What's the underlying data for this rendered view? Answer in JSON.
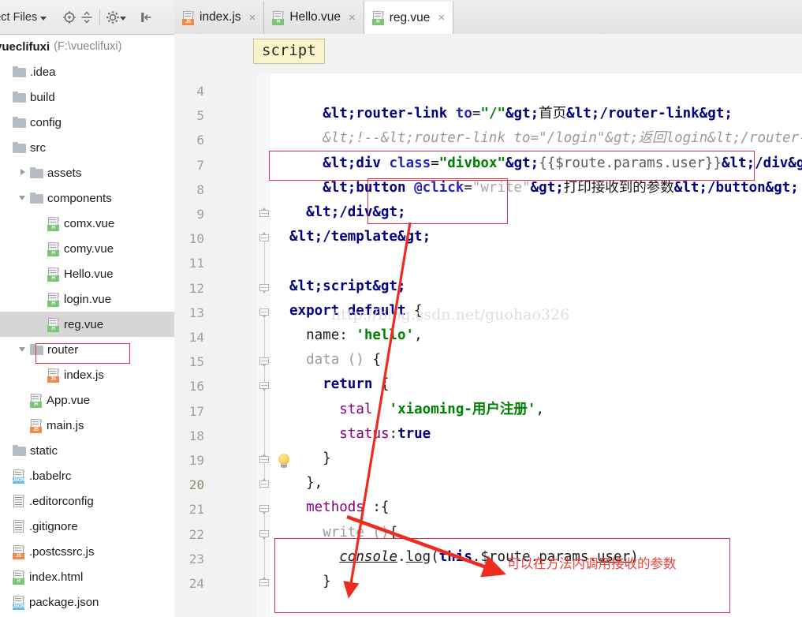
{
  "toolbar": {
    "project_selector_label": "ject Files",
    "icons": [
      "locate-target-icon",
      "collapse-all-icon",
      "settings-gear-icon",
      "hide-panel-icon"
    ]
  },
  "sidebar": {
    "root": {
      "name": "vueclifuxi",
      "path": "(F:\\vueclifuxi)"
    },
    "selected_item": "reg.vue",
    "items": [
      {
        "label": ".idea",
        "kind": "folder",
        "indent": 0,
        "arrow": "none"
      },
      {
        "label": "build",
        "kind": "folder",
        "indent": 0,
        "arrow": "none"
      },
      {
        "label": "config",
        "kind": "folder",
        "indent": 0,
        "arrow": "none"
      },
      {
        "label": "src",
        "kind": "folder",
        "indent": 0,
        "arrow": "none"
      },
      {
        "label": "assets",
        "kind": "folder",
        "indent": 1,
        "arrow": "right"
      },
      {
        "label": "components",
        "kind": "folder",
        "indent": 1,
        "arrow": "down"
      },
      {
        "label": "comx.vue",
        "kind": "vue",
        "indent": 2,
        "arrow": "none"
      },
      {
        "label": "comy.vue",
        "kind": "vue",
        "indent": 2,
        "arrow": "none"
      },
      {
        "label": "Hello.vue",
        "kind": "vue",
        "indent": 2,
        "arrow": "none"
      },
      {
        "label": "login.vue",
        "kind": "vue",
        "indent": 2,
        "arrow": "none"
      },
      {
        "label": "reg.vue",
        "kind": "vue",
        "indent": 2,
        "arrow": "none",
        "selected": true
      },
      {
        "label": "router",
        "kind": "folder",
        "indent": 1,
        "arrow": "down"
      },
      {
        "label": "index.js",
        "kind": "js",
        "indent": 2,
        "arrow": "none"
      },
      {
        "label": "App.vue",
        "kind": "vue",
        "indent": 1,
        "arrow": "none"
      },
      {
        "label": "main.js",
        "kind": "js",
        "indent": 1,
        "arrow": "none"
      },
      {
        "label": "static",
        "kind": "folder",
        "indent": 0,
        "arrow": "none"
      },
      {
        "label": ".babelrc",
        "kind": "json",
        "indent": 0,
        "arrow": "none"
      },
      {
        "label": ".editorconfig",
        "kind": "txt",
        "indent": 0,
        "arrow": "none"
      },
      {
        "label": ".gitignore",
        "kind": "txt",
        "indent": 0,
        "arrow": "none"
      },
      {
        "label": ".postcssrc.js",
        "kind": "js",
        "indent": 0,
        "arrow": "none"
      },
      {
        "label": "index.html",
        "kind": "vue",
        "indent": 0,
        "arrow": "none"
      },
      {
        "label": "package.json",
        "kind": "json",
        "indent": 0,
        "arrow": "none"
      }
    ]
  },
  "tabs": [
    {
      "label": "index.js",
      "kind": "js",
      "active": false,
      "close": "×"
    },
    {
      "label": "Hello.vue",
      "kind": "vue",
      "active": false,
      "close": "×"
    },
    {
      "label": "reg.vue",
      "kind": "vue",
      "active": true,
      "close": "×"
    }
  ],
  "breadcrumb": {
    "label": "script"
  },
  "editor": {
    "current_line": 20,
    "line_numbers": [
      "4",
      "5",
      "6",
      "7",
      "8",
      "9",
      "10",
      "11",
      "12",
      "13",
      "14",
      "15",
      "16",
      "17",
      "18",
      "19",
      "20",
      "21",
      "22",
      "23",
      "24"
    ],
    "lines": [
      {
        "n": "4",
        "text": ""
      },
      {
        "n": "5",
        "text": "    <router-link to=\"/\">首页</router-link>"
      },
      {
        "n": "6",
        "text": "    <!--<router-link to=\"/login\">返回login</router-link>-->"
      },
      {
        "n": "7",
        "text": "    <div class=\"divbox\">{{$route.params.user}}</div>"
      },
      {
        "n": "8",
        "text": "    <button @click=\"write\">打印接收到的参数</button>"
      },
      {
        "n": "9",
        "text": "  </div>"
      },
      {
        "n": "10",
        "text": "</template>"
      },
      {
        "n": "11",
        "text": ""
      },
      {
        "n": "12",
        "text": "<script>"
      },
      {
        "n": "13",
        "text": "export default {"
      },
      {
        "n": "14",
        "text": "  name: 'hello',"
      },
      {
        "n": "15",
        "text": "  data () {"
      },
      {
        "n": "16",
        "text": "    return {"
      },
      {
        "n": "17",
        "text": "      stal  'xiaoming-用户注册',"
      },
      {
        "n": "18",
        "text": "      status:true"
      },
      {
        "n": "19",
        "text": "    }"
      },
      {
        "n": "20",
        "text": "  },"
      },
      {
        "n": "21",
        "text": "  methods :{"
      },
      {
        "n": "22",
        "text": "    write (){"
      },
      {
        "n": "23",
        "text": "      console.log(this.$route.params.user)"
      },
      {
        "n": "24",
        "text": "    }"
      }
    ]
  },
  "annotations": {
    "note_text": "可以在方法内调用接收的参数",
    "accent_color": "#d0324b",
    "arrow_color": "#ee2b1f",
    "boxes": [
      {
        "name": "divbox-line-box"
      },
      {
        "name": "click-attr-box"
      },
      {
        "name": "write-method-box"
      },
      {
        "name": "reg-vue-tree-box"
      }
    ]
  },
  "watermark": {
    "text": "http://blog.csdn.net/guohao326"
  }
}
